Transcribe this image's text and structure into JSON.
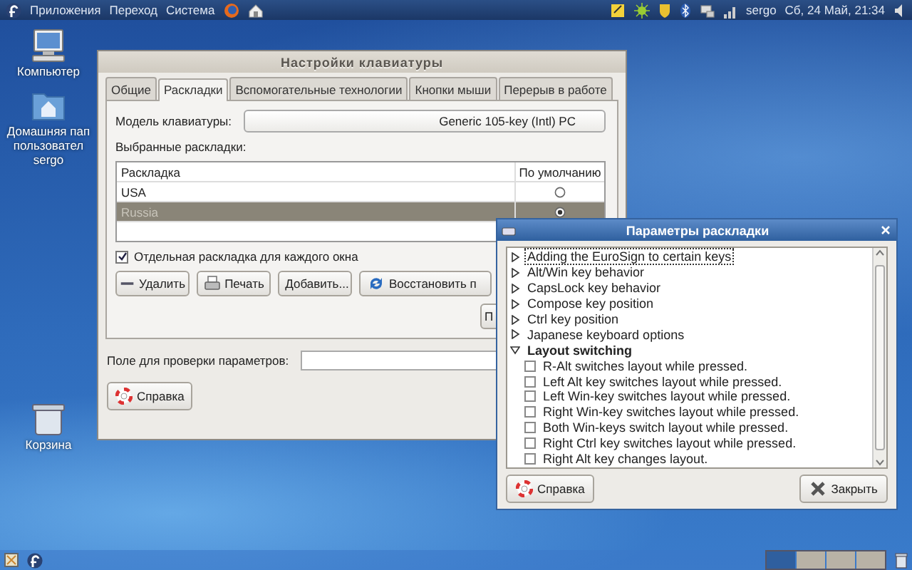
{
  "top_panel": {
    "menus": [
      "Приложения",
      "Переход",
      "Система"
    ],
    "user": "sergo",
    "clock": "Сб, 24 Май, 21:34"
  },
  "desktop_icons": [
    {
      "kind": "computer",
      "lines": [
        "Компьютер"
      ]
    },
    {
      "kind": "home",
      "lines": [
        "Домашняя пап",
        "пользовател",
        "sergo"
      ]
    },
    {
      "kind": "trash",
      "lines": [
        "Корзина"
      ]
    }
  ],
  "keyboard_window": {
    "title": "Настройки клавиатуры",
    "tabs": [
      {
        "label": "Общие",
        "selected": false
      },
      {
        "label": "Раскладки",
        "selected": true
      },
      {
        "label": "Вспомогательные технологии",
        "selected": false
      },
      {
        "label": "Кнопки мыши",
        "selected": false
      },
      {
        "label": "Перерыв в работе",
        "selected": false
      }
    ],
    "model_label": "Модель клавиатуры:",
    "model_value": "Generic 105-key (Intl) PC",
    "layouts_label": "Выбранные раскладки:",
    "table": {
      "columns": [
        "Раскладка",
        "По умолчанию"
      ],
      "rows": [
        {
          "layout": "USA",
          "selected": false,
          "default": false
        },
        {
          "layout": "Russia",
          "selected": true,
          "default": true
        }
      ]
    },
    "separate_layout": {
      "label": "Отдельная раскладка для каждого окна",
      "checked": true
    },
    "buttons": [
      {
        "kind": "remove",
        "label": "Удалить"
      },
      {
        "kind": "print",
        "label": "Печать"
      },
      {
        "kind": "add",
        "label": "Добавить..."
      },
      {
        "kind": "reset",
        "label": "Восстановить п"
      }
    ],
    "partial_button": "П",
    "test_field_label": "Поле для проверки параметров:",
    "help_button": "Справка"
  },
  "options_window": {
    "title": "Параметры раскладки",
    "items": [
      {
        "label": "Adding the EuroSign to certain keys",
        "expanded": false,
        "focused": true
      },
      {
        "label": "Alt/Win key behavior",
        "expanded": false,
        "focused": false
      },
      {
        "label": "CapsLock key behavior",
        "expanded": false,
        "focused": false
      },
      {
        "label": "Compose key position",
        "expanded": false,
        "focused": false
      },
      {
        "label": "Ctrl key position",
        "expanded": false,
        "focused": false
      },
      {
        "label": "Japanese keyboard options",
        "expanded": false,
        "focused": false
      },
      {
        "label": "Layout switching",
        "expanded": true,
        "focused": false,
        "children": [
          {
            "label": "R-Alt switches layout while pressed.",
            "checked": false
          },
          {
            "label": "Left Alt key switches layout while pressed.",
            "checked": false
          },
          {
            "label": "Left Win-key switches layout while pressed.",
            "checked": false
          },
          {
            "label": "Right Win-key switches layout while pressed.",
            "checked": false
          },
          {
            "label": "Both Win-keys switch layout while pressed.",
            "checked": false
          },
          {
            "label": "Right Ctrl key switches layout while pressed.",
            "checked": false
          },
          {
            "label": "Right Alt key changes layout.",
            "checked": false
          }
        ]
      }
    ],
    "help_button": "Справка",
    "close_button": "Закрыть"
  },
  "bottom_panel": {
    "workspaces": [
      {
        "selected": true
      },
      {
        "selected": false
      },
      {
        "selected": false
      },
      {
        "selected": false
      }
    ]
  }
}
